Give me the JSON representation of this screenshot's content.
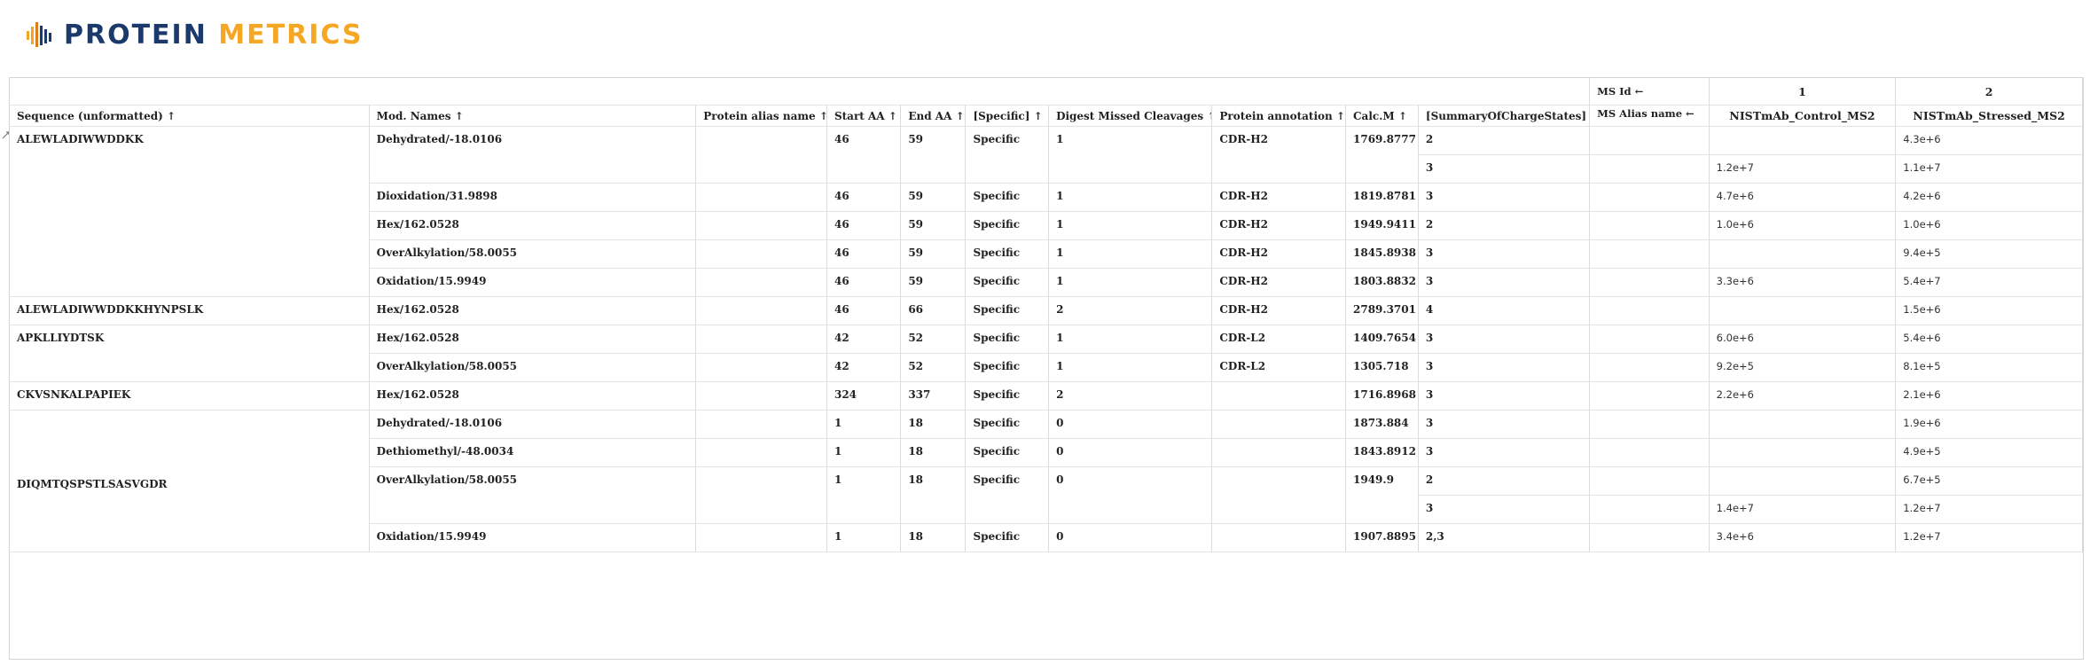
{
  "logo": {
    "word1": "PROTEIN",
    "word2": "METRICS"
  },
  "colors": {
    "logo_dark": "#1b3a6b",
    "logo_accent": "#f5a623",
    "border": "#d4d4d4"
  },
  "ms_header": {
    "ms_id_label": "MS Id ←",
    "ms_alias_label": "MS Alias name ←",
    "ids": [
      "1",
      "2"
    ],
    "names": [
      "NISTmAb_Control_MS2",
      "NISTmAb_Stressed_MS2"
    ]
  },
  "columns": [
    "Sequence (unformatted) ↑",
    "Mod. Names ↑",
    "Protein alias name ↑",
    "Start AA ↑",
    "End AA ↑",
    "[Specific] ↑",
    "Digest Missed Cleavages ↑",
    "Protein annotation ↑",
    "Calc.M ↑",
    "[SummaryOfChargeStates] ↑"
  ],
  "groups": [
    {
      "sequence": "ALEWLADIWWDDKK",
      "rows": [
        {
          "mod": "Dehydrated/-18.0106",
          "alias": "",
          "start": "46",
          "end": "59",
          "specific": "Specific",
          "missed": "1",
          "annotation": "CDR-H2",
          "calc": "1769.8777",
          "charges": [
            {
              "z": "2",
              "ms1": "",
              "ms2": "4.3e+6"
            },
            {
              "z": "3",
              "ms1": "1.2e+7",
              "ms2": "1.1e+7"
            }
          ]
        },
        {
          "mod": "Dioxidation/31.9898",
          "alias": "",
          "start": "46",
          "end": "59",
          "specific": "Specific",
          "missed": "1",
          "annotation": "CDR-H2",
          "calc": "1819.8781",
          "charges": [
            {
              "z": "3",
              "ms1": "4.7e+6",
              "ms2": "4.2e+6"
            }
          ]
        },
        {
          "mod": "Hex/162.0528",
          "alias": "",
          "start": "46",
          "end": "59",
          "specific": "Specific",
          "missed": "1",
          "annotation": "CDR-H2",
          "calc": "1949.9411",
          "charges": [
            {
              "z": "2",
              "ms1": "1.0e+6",
              "ms2": "1.0e+6"
            }
          ]
        },
        {
          "mod": "OverAlkylation/58.0055",
          "alias": "",
          "start": "46",
          "end": "59",
          "specific": "Specific",
          "missed": "1",
          "annotation": "CDR-H2",
          "calc": "1845.8938",
          "charges": [
            {
              "z": "3",
              "ms1": "",
              "ms2": "9.4e+5"
            }
          ]
        },
        {
          "mod": "Oxidation/15.9949",
          "alias": "",
          "start": "46",
          "end": "59",
          "specific": "Specific",
          "missed": "1",
          "annotation": "CDR-H2",
          "calc": "1803.8832",
          "charges": [
            {
              "z": "3",
              "ms1": "3.3e+6",
              "ms2": "5.4e+7"
            }
          ]
        }
      ]
    },
    {
      "sequence": "ALEWLADIWWDDKKHYNPSLK",
      "rows": [
        {
          "mod": "Hex/162.0528",
          "alias": "",
          "start": "46",
          "end": "66",
          "specific": "Specific",
          "missed": "2",
          "annotation": "CDR-H2",
          "calc": "2789.3701",
          "charges": [
            {
              "z": "4",
              "ms1": "",
              "ms2": "1.5e+6"
            }
          ]
        }
      ]
    },
    {
      "sequence": "APKLLIYDTSK",
      "rows": [
        {
          "mod": "Hex/162.0528",
          "alias": "",
          "start": "42",
          "end": "52",
          "specific": "Specific",
          "missed": "1",
          "annotation": "CDR-L2",
          "calc": "1409.7654",
          "charges": [
            {
              "z": "3",
              "ms1": "6.0e+6",
              "ms2": "5.4e+6"
            }
          ]
        },
        {
          "mod": "OverAlkylation/58.0055",
          "alias": "",
          "start": "42",
          "end": "52",
          "specific": "Specific",
          "missed": "1",
          "annotation": "CDR-L2",
          "calc": "1305.718",
          "charges": [
            {
              "z": "3",
              "ms1": "9.2e+5",
              "ms2": "8.1e+5"
            }
          ]
        }
      ]
    },
    {
      "sequence": "CKVSNKALPAPIEK",
      "rows": [
        {
          "mod": "Hex/162.0528",
          "alias": "",
          "start": "324",
          "end": "337",
          "specific": "Specific",
          "missed": "2",
          "annotation": "",
          "calc": "1716.8968",
          "charges": [
            {
              "z": "3",
              "ms1": "2.2e+6",
              "ms2": "2.1e+6"
            }
          ]
        }
      ]
    },
    {
      "sequence": "DIQMTQSPSTLSASVGDR",
      "rows": [
        {
          "mod": "Dehydrated/-18.0106",
          "alias": "",
          "start": "1",
          "end": "18",
          "specific": "Specific",
          "missed": "0",
          "annotation": "",
          "calc": "1873.884",
          "charges": [
            {
              "z": "3",
              "ms1": "",
              "ms2": "1.9e+6"
            }
          ]
        },
        {
          "mod": "Dethiomethyl/-48.0034",
          "alias": "",
          "start": "1",
          "end": "18",
          "specific": "Specific",
          "missed": "0",
          "annotation": "",
          "calc": "1843.8912",
          "charges": [
            {
              "z": "3",
              "ms1": "",
              "ms2": "4.9e+5"
            }
          ]
        },
        {
          "mod": "OverAlkylation/58.0055",
          "alias": "",
          "start": "1",
          "end": "18",
          "specific": "Specific",
          "missed": "0",
          "annotation": "",
          "calc": "1949.9",
          "charges": [
            {
              "z": "2",
              "ms1": "",
              "ms2": "6.7e+5"
            },
            {
              "z": "3",
              "ms1": "1.4e+7",
              "ms2": "1.2e+7"
            }
          ]
        },
        {
          "mod": "Oxidation/15.9949",
          "alias": "",
          "start": "1",
          "end": "18",
          "specific": "Specific",
          "missed": "0",
          "annotation": "",
          "calc": "1907.8895",
          "charges": [
            {
              "z": "2,3",
              "ms1": "3.4e+6",
              "ms2": "1.2e+7"
            }
          ]
        }
      ]
    }
  ]
}
